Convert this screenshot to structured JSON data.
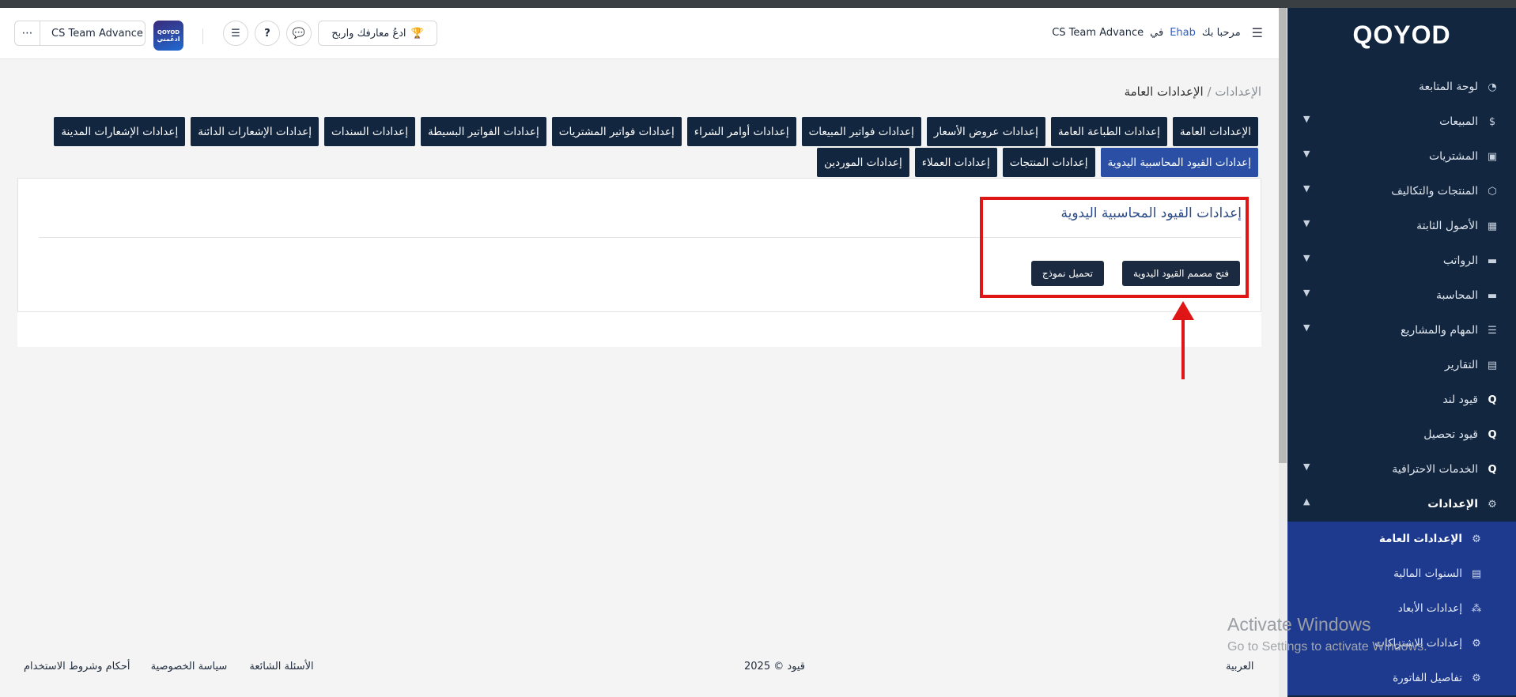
{
  "header": {
    "welcome_prefix": "مرحبا بك",
    "user_name": "Ehab",
    "welcome_in": "في",
    "company_name": "CS Team Advance",
    "learn_button": "ادعُ معارفك واربح",
    "company_switch": "CS Team Advance",
    "company_logo_text": "QOYOD",
    "company_logo_sub": "ادعُمني"
  },
  "sidebar": {
    "logo": "QOYOD",
    "items": [
      {
        "label": "لوحة المتابعة",
        "icon": "dashboard-icon",
        "chevron": false
      },
      {
        "label": "المبيعات",
        "icon": "sales-icon",
        "chevron": true
      },
      {
        "label": "المشتريات",
        "icon": "purchases-icon",
        "chevron": true
      },
      {
        "label": "المنتجات والتكاليف",
        "icon": "box-icon",
        "chevron": true
      },
      {
        "label": "الأصول الثابتة",
        "icon": "table-icon",
        "chevron": true
      },
      {
        "label": "الرواتب",
        "icon": "folder-icon",
        "chevron": true
      },
      {
        "label": "المحاسبة",
        "icon": "folder-icon",
        "chevron": true
      },
      {
        "label": "المهام والمشاريع",
        "icon": "list-icon",
        "chevron": true
      },
      {
        "label": "التقارير",
        "icon": "report-icon",
        "chevron": false
      },
      {
        "label": "قيود لند",
        "icon": "qoyod-icon",
        "chevron": false
      },
      {
        "label": "قيود تحصيل",
        "icon": "qoyod-icon",
        "chevron": false
      },
      {
        "label": "الخدمات الاحترافية",
        "icon": "qoyod-icon",
        "chevron": true
      },
      {
        "label": "الإعدادات",
        "icon": "gear-icon",
        "chevron": true
      }
    ],
    "sub_items": [
      {
        "label": "الإعدادات العامة",
        "icon": "gear-icon"
      },
      {
        "label": "السنوات المالية",
        "icon": "calendar-icon"
      },
      {
        "label": "إعدادات الأبعاد",
        "icon": "dimensions-icon"
      },
      {
        "label": "إعدادات الاشتراكات",
        "icon": "gear-icon"
      },
      {
        "label": "تفاصيل الفاتورة",
        "icon": "gear-icon"
      }
    ]
  },
  "breadcrumb": {
    "parent": "الإعدادات",
    "separator": "/",
    "current": "الإعدادات العامة"
  },
  "tabs_row1": [
    "الإعدادات العامة",
    "إعدادات الطباعة العامة",
    "إعدادات عروض الأسعار",
    "إعدادات فواتير المبيعات",
    "إعدادات أوامر الشراء",
    "إعدادات فواتير المشتريات",
    "إعدادات الفواتير البسيطة",
    "إعدادات السندات",
    "إعدادات الإشعارات الدائنة",
    "إعدادات الإشعارات المدينة"
  ],
  "tabs_row2": [
    "إعدادات القيود المحاسبية اليدوية",
    "إعدادات المنتجات",
    "إعدادات العملاء",
    "إعدادات الموردين"
  ],
  "card": {
    "title": "إعدادات القيود المحاسبية اليدوية",
    "open_designer_button": "فتح مصمم القيود اليدوية",
    "load_template_button": "تحميل نموذج"
  },
  "footer": {
    "language": "العربية",
    "copyright": "قيود © 2025",
    "terms": "أحكام وشروط الاستخدام",
    "privacy": "سياسة الخصوصية",
    "faq": "الأسئلة الشائعة"
  },
  "watermark": {
    "line1": "Activate Windows",
    "line2": "Go to Settings to activate Windows."
  },
  "colors": {
    "sidebar_bg": "#12263f",
    "submenu_bg": "#1d3a8f",
    "tab_bg": "#12263f",
    "tab_active_bg": "#2a4fa5",
    "annotation_red": "#e01515"
  }
}
